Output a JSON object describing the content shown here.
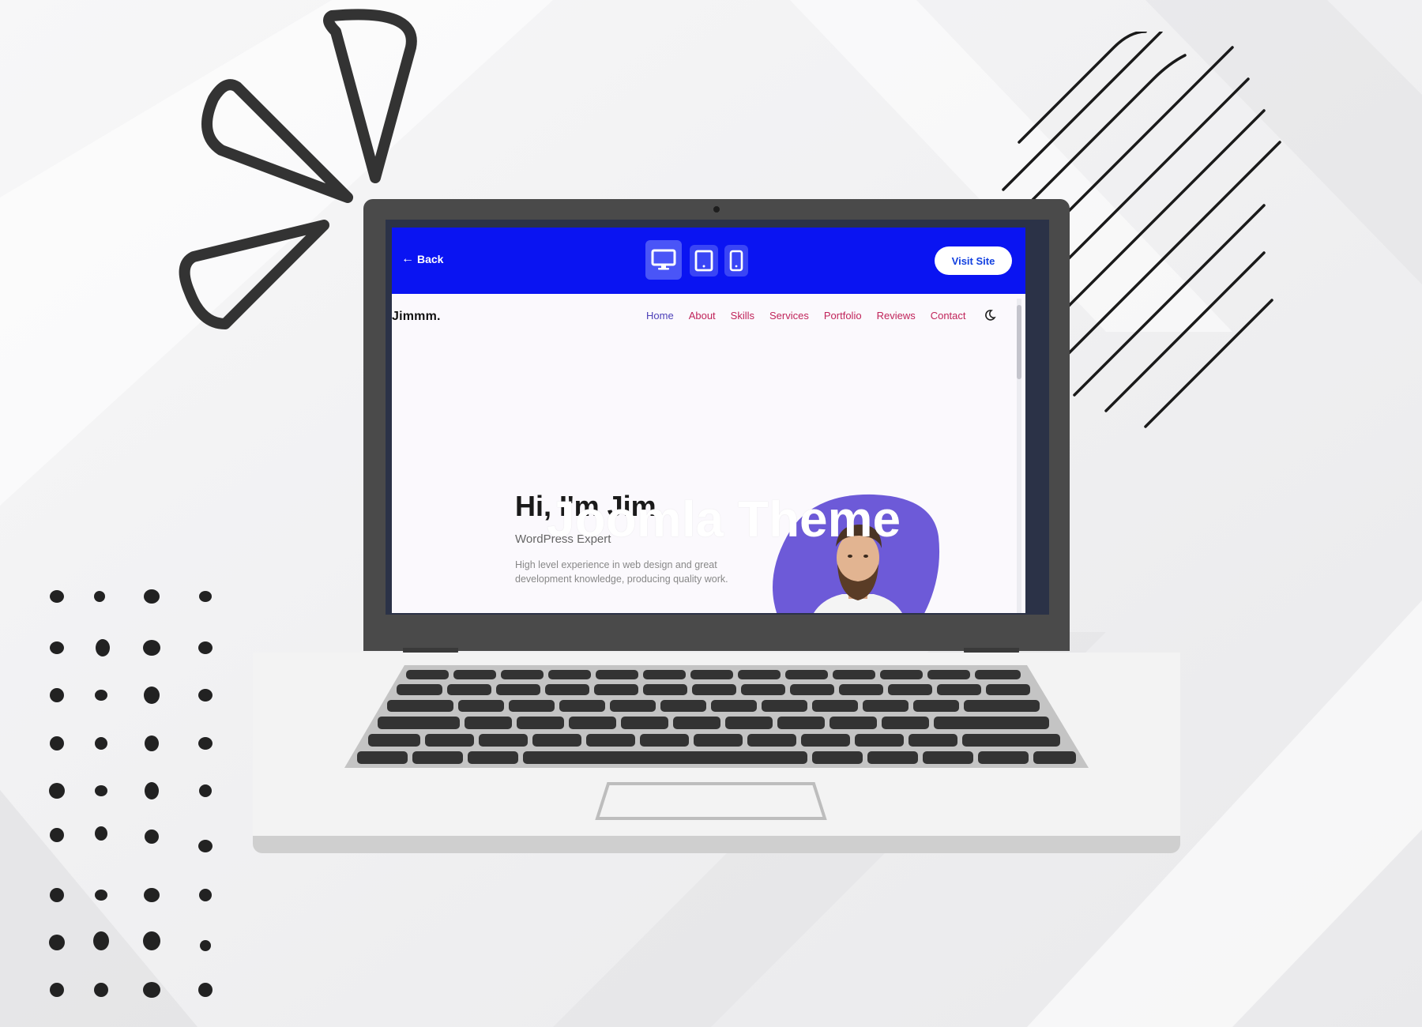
{
  "toolbar": {
    "back_label": "Back",
    "devices": [
      "desktop-icon",
      "tablet-icon",
      "mobile-icon"
    ],
    "active_device": "desktop",
    "visit_label": "Visit Site",
    "color": "#0a14f2"
  },
  "site": {
    "brand": "Jimmm.",
    "nav": [
      "Home",
      "About",
      "Skills",
      "Services",
      "Portfolio",
      "Reviews",
      "Contact"
    ],
    "active_nav": "Home",
    "theme_toggle_icon": "moon-icon"
  },
  "hero": {
    "title": "Hi, I'm Jim",
    "overlay_title": "Joomla Theme",
    "subtitle": "WordPress Expert",
    "description": "High level experience in web design and great development knowledge, producing quality work.",
    "blob_color": "#6d5ad8"
  },
  "colors": {
    "nav_text": "#c0245a",
    "nav_active": "#4c3fb8",
    "visit_text": "#1240e0"
  }
}
